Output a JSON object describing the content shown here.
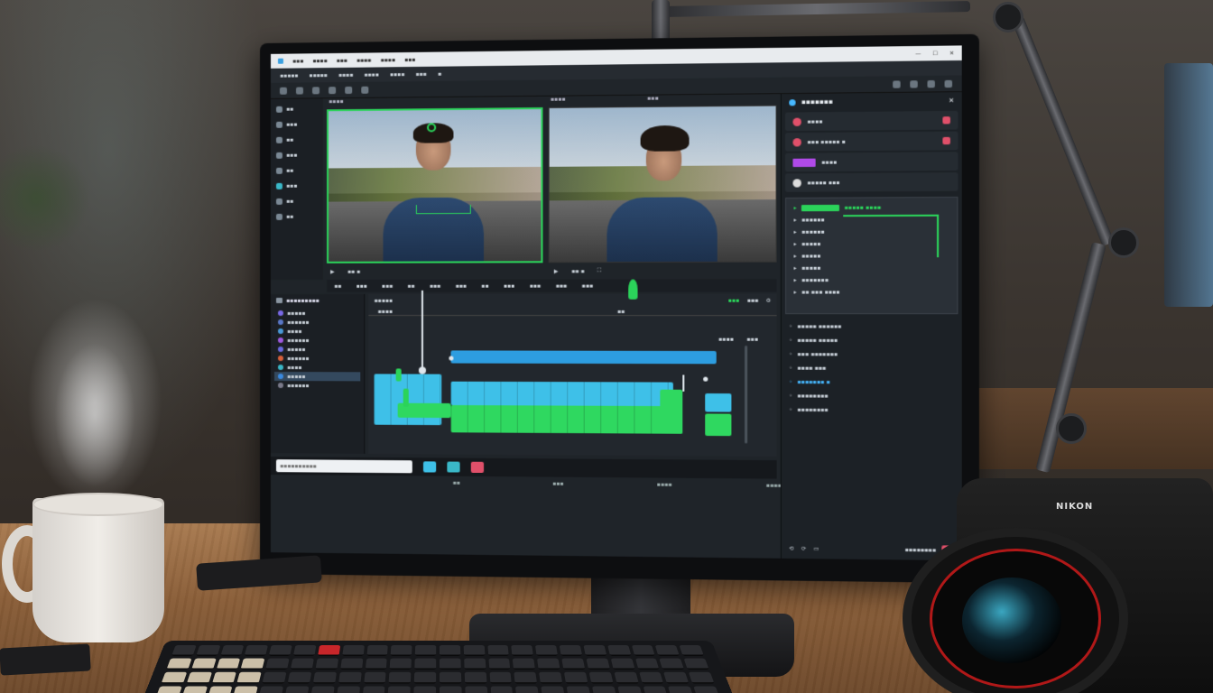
{
  "scene": {
    "camera_brand": "NIKON",
    "colors": {
      "accent_green": "#2bd35a",
      "clip_blue": "#2d9de0",
      "clip_light_blue": "#3ec0e8",
      "clip_green": "#2fd860",
      "effect_purple": "#b04ae8",
      "effect_red": "#e0506a",
      "highlight_blue": "#46b8ff"
    }
  },
  "editor": {
    "titlebar": {
      "tabs": [
        "▪▪▪",
        "▪▪▪▪",
        "▪▪▪",
        "▪▪▪▪",
        "▪▪▪▪",
        "▪▪▪"
      ],
      "controls": [
        "—",
        "☐",
        "✕"
      ]
    },
    "menubar": {
      "items": [
        "▪▪▪▪▪",
        "▪▪▪▪▪",
        "▪▪▪▪",
        "▪▪▪▪",
        "▪▪▪▪",
        "▪▪▪",
        "▪"
      ]
    },
    "toolbar": {
      "left_icons": [
        "cursor-icon",
        "cut-icon",
        "layers-icon",
        "grid-icon",
        "link-icon",
        "lock-icon"
      ],
      "right_icons": [
        "zoom-icon",
        "settings-icon",
        "info-icon",
        "close-icon"
      ]
    },
    "left_rail": {
      "items": [
        "▪▪",
        "▪▪▪",
        "▪▪",
        "▪▪▪",
        "▪▪",
        "▪▪▪",
        "▪▪",
        "▪▪"
      ]
    },
    "source_viewer": {
      "label": "▪▪▪▪",
      "timecode": "▪▪ ▪"
    },
    "program_viewer": {
      "label": "▪▪▪▪",
      "timecode": "▪▪ ▪",
      "right_label": "▪▪▪"
    },
    "scrub_row": {
      "items": [
        "▪▪",
        "▪▪▪",
        "▪▪▪",
        "▪▪",
        "▪▪▪",
        "▪▪▪",
        "▪▪",
        "▪▪▪",
        "▪▪▪",
        "▪▪▪",
        "▪▪▪"
      ]
    },
    "bins": {
      "title": "▪▪▪▪▪▪▪▪▪",
      "items": [
        {
          "label": "▪▪▪▪▪",
          "color": "#7a6ae8"
        },
        {
          "label": "▪▪▪▪▪▪",
          "color": "#5a78c8"
        },
        {
          "label": "▪▪▪▪",
          "color": "#4a9ad8"
        },
        {
          "label": "▪▪▪▪▪▪",
          "color": "#a05ae0"
        },
        {
          "label": "▪▪▪▪▪",
          "color": "#6a6ae0"
        },
        {
          "label": "▪▪▪▪▪▪",
          "color": "#d8603a"
        },
        {
          "label": "▪▪▪▪",
          "color": "#3ab8c8"
        },
        {
          "label": "▪▪▪▪▪",
          "color": "#3a8ae0"
        },
        {
          "label": "▪▪▪▪▪▪",
          "color": "#7a7a8a"
        }
      ],
      "selected_index": 7
    },
    "timeline": {
      "left_label": "▪▪▪▪▪",
      "right_labels": [
        "▪▪▪",
        "▪▪▪"
      ],
      "ruler_label": "▪▪▪▪",
      "zoom_labels": [
        "▪▪▪▪",
        "▪▪▪"
      ],
      "playhead_time": "▪▪"
    },
    "statusbar": {
      "search_placeholder": "▪▪▪▪▪▪▪▪▪▪",
      "page_labels": [
        "▪▪",
        "▪▪▪",
        "▪▪▪▪",
        "▪▪▪▪"
      ]
    },
    "effects_panel": {
      "title": "▪▪▪▪▪▪▪",
      "effects": [
        {
          "label": "▪▪▪▪",
          "badge_color": "#e0506a"
        },
        {
          "label": "▪▪▪ ▪▪▪▪▪ ▪",
          "badge_color": "#e0506a"
        },
        {
          "label": "▪▪▪▪",
          "badge_color": "#b04ae8"
        },
        {
          "label": "▪▪▪▪▪ ▪▪▪",
          "badge_color": "#dddddd"
        }
      ],
      "properties": [
        "▪▪▪▪▪ ▪▪▪▪",
        "▪▪▪▪▪▪",
        "▪▪▪▪▪▪",
        "▪▪▪▪▪",
        "▪▪▪▪▪",
        "▪▪▪▪▪",
        "▪▪▪▪▪▪▪",
        "▪▪ ▪▪▪ ▪▪▪▪"
      ],
      "presets": [
        "▪▪▪▪▪ ▪▪▪▪▪▪",
        "▪▪▪▪▪ ▪▪▪▪▪",
        "▪▪▪ ▪▪▪▪▪▪▪",
        "▪▪▪▪ ▪▪▪",
        "▪▪▪▪▪▪▪ ▪",
        "▪▪▪▪▪▪▪▪",
        "▪▪▪▪▪▪▪▪"
      ],
      "highlight_preset_index": 4,
      "footer_label": "▪▪▪▪▪▪▪▪"
    }
  }
}
